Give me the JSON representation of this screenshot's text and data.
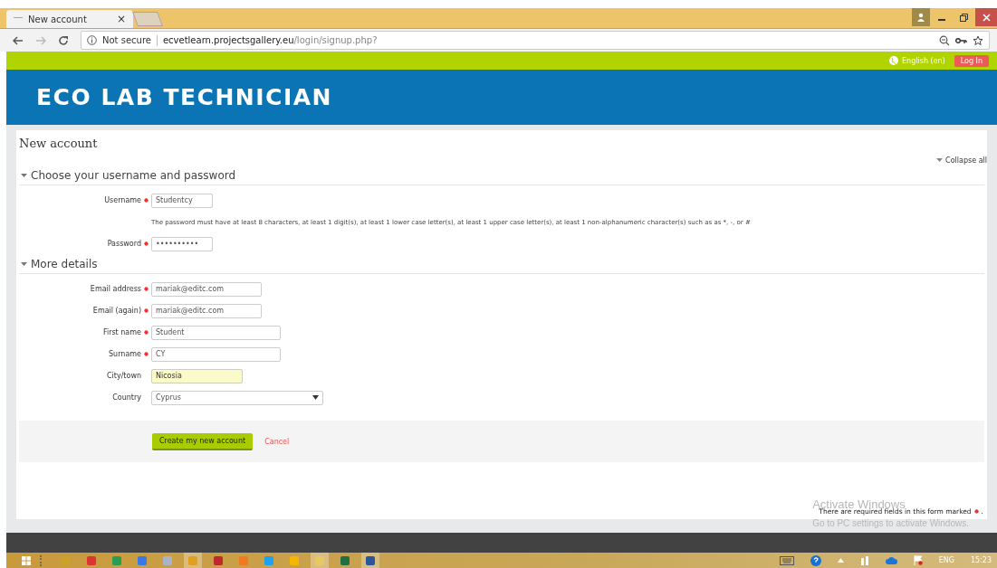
{
  "browser": {
    "tab_title": "New account",
    "tab_close": "×",
    "security": "Not secure",
    "url_host": "ecvetlearn.projectsgallery.eu",
    "url_path": "/login/signup.php?"
  },
  "site": {
    "language": "English (en)",
    "login": "Log In",
    "logo": "ECO LAB TECHNICIAN"
  },
  "page": {
    "heading": "New account",
    "collapse_all": "Collapse all",
    "sections": [
      {
        "title": "Choose your username and password",
        "expanded": true,
        "fields": [
          {
            "kind": "text",
            "label": "Username",
            "required": true,
            "value": "Studentcy",
            "autofilled": false
          },
          {
            "kind": "note",
            "text": "The password must have at least 8 characters, at least 1 digit(s), at least 1 lower case letter(s), at least 1 upper case letter(s), at least 1 non-alphanumeric character(s) such as as *, -, or #"
          },
          {
            "kind": "text",
            "label": "Password",
            "required": true,
            "value": "••••••••••",
            "autofilled": false
          }
        ]
      },
      {
        "title": "More details",
        "expanded": true,
        "fields": [
          {
            "kind": "text",
            "label": "Email address",
            "required": true,
            "value": "mariak@editc.com",
            "autofilled": false
          },
          {
            "kind": "text",
            "label": "Email (again)",
            "required": true,
            "value": "mariak@editc.com",
            "autofilled": false
          },
          {
            "kind": "text",
            "label": "First name",
            "required": true,
            "value": "Student",
            "autofilled": false
          },
          {
            "kind": "text",
            "label": "Surname",
            "required": true,
            "value": "CY",
            "autofilled": false
          },
          {
            "kind": "text",
            "label": "City/town",
            "required": false,
            "value": "Nicosia",
            "autofilled": true
          },
          {
            "kind": "select",
            "label": "Country",
            "required": false,
            "value": "Cyprus",
            "autofilled": false
          }
        ]
      }
    ],
    "submit": "Create my new account",
    "cancel": "Cancel",
    "required_note": "There are required fields in this form marked",
    "required_note_end": "."
  },
  "overlay": {
    "title": "Activate Windows",
    "subtitle": "Go to PC settings to activate Windows."
  },
  "taskbar": {
    "apps": [
      {
        "kind": "folder-app",
        "selected": false
      },
      {
        "kind": "red-app",
        "selected": false
      },
      {
        "kind": "sheet-app",
        "selected": false
      },
      {
        "kind": "doc-app",
        "selected": false
      },
      {
        "kind": "mail-app",
        "selected": false
      },
      {
        "kind": "browser-app",
        "selected": true
      },
      {
        "kind": "pdf-app",
        "selected": false
      },
      {
        "kind": "orange-app",
        "selected": false
      },
      {
        "kind": "chat-app",
        "selected": false
      },
      {
        "kind": "note-app",
        "selected": false
      },
      {
        "kind": "explorer-app",
        "selected": true
      },
      {
        "kind": "excel-app",
        "selected": false
      },
      {
        "kind": "word-app",
        "selected": true
      }
    ],
    "language": "ENG",
    "clock": "15:23"
  }
}
